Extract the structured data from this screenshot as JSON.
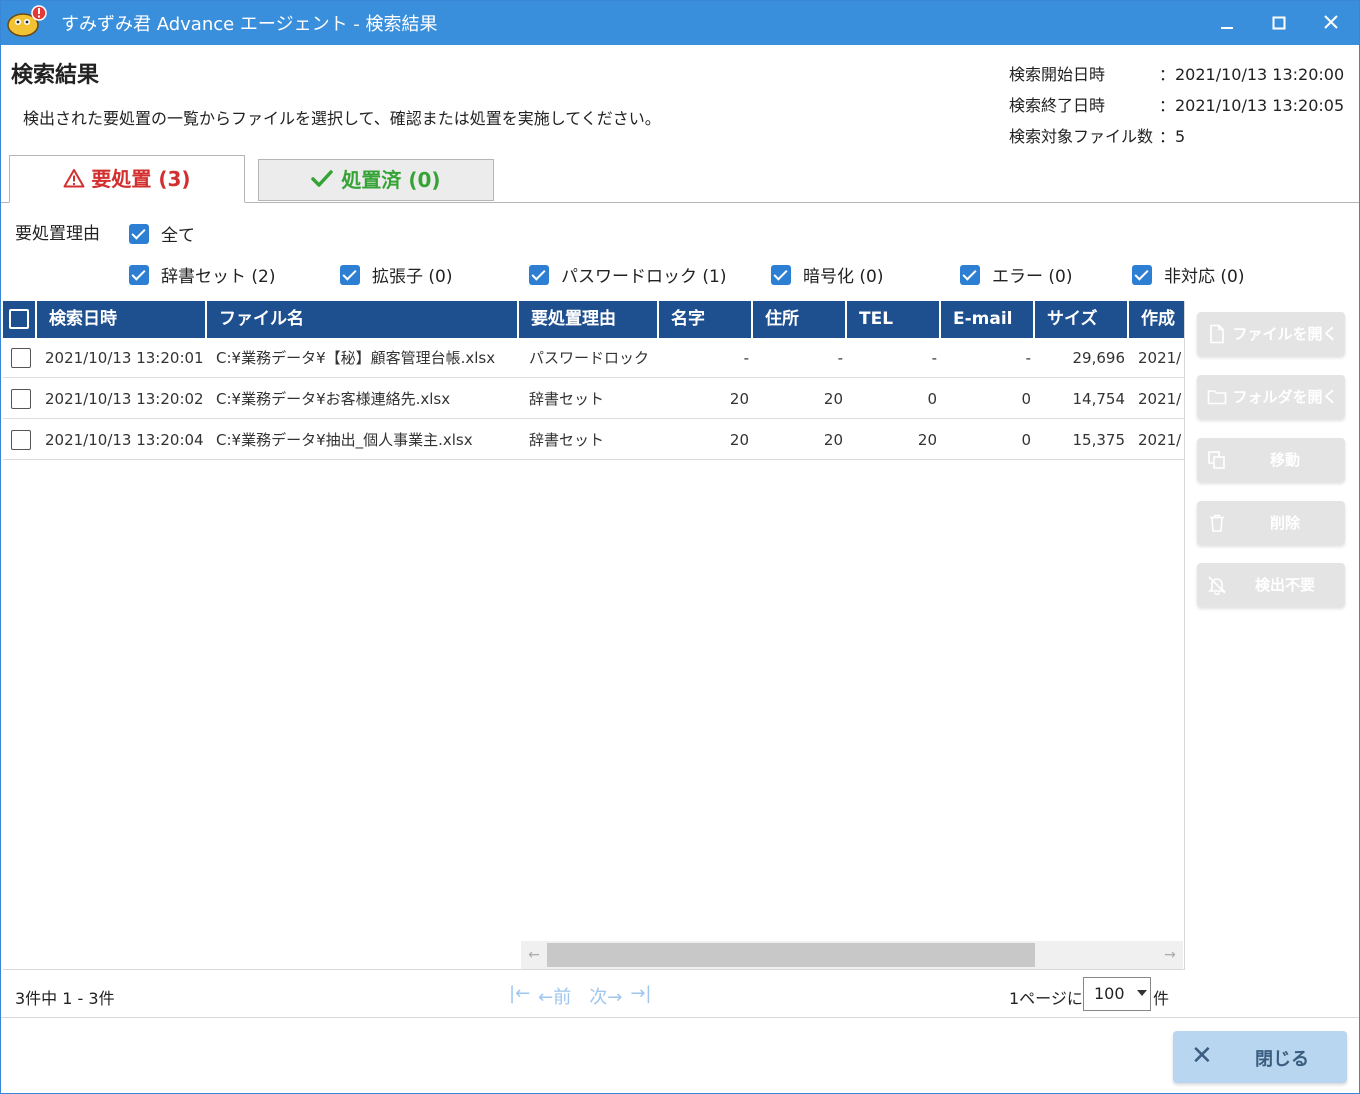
{
  "window": {
    "title": "すみずみ君 Advance エージェント - 検索結果"
  },
  "page": {
    "title": "検索結果",
    "description": "検出された要処置の一覧からファイルを選択して、確認または処置を実施してください。"
  },
  "meta": [
    {
      "label": "検索開始日時",
      "value": "：2021/10/13 13:20:00"
    },
    {
      "label": "検索終了日時",
      "value": "：2021/10/13 13:20:05"
    },
    {
      "label": "検索対象ファイル数",
      "value": "：5"
    }
  ],
  "tabs": [
    {
      "label": "要処置 (3)",
      "icon": "warning-icon",
      "color": "#d32f2f"
    },
    {
      "label": "処置済 (0)",
      "icon": "check-icon",
      "color": "#36a336"
    }
  ],
  "filters": {
    "label": "要処置理由",
    "all": "全て",
    "items": [
      "辞書セット (2)",
      "拡張子 (0)",
      "パスワードロック (1)",
      "暗号化 (0)",
      "エラー (0)",
      "非対応 (0)"
    ]
  },
  "table": {
    "columns": [
      "検索日時",
      "ファイル名",
      "要処置理由",
      "名字",
      "住所",
      "TEL",
      "E-mail",
      "サイズ",
      "作成"
    ],
    "rows": [
      [
        "2021/10/13 13:20:01",
        "C:¥業務データ¥【秘】顧客管理台帳.xlsx",
        "パスワードロック",
        "-",
        "-",
        "-",
        "-",
        "29,696",
        "2021/"
      ],
      [
        "2021/10/13 13:20:02",
        "C:¥業務データ¥お客様連絡先.xlsx",
        "辞書セット",
        "20",
        "20",
        "0",
        "0",
        "14,754",
        "2021/"
      ],
      [
        "2021/10/13 13:20:04",
        "C:¥業務データ¥抽出_個人事業主.xlsx",
        "辞書セット",
        "20",
        "20",
        "20",
        "0",
        "15,375",
        "2021/"
      ]
    ]
  },
  "side_buttons": [
    {
      "label": "ファイルを開く",
      "icon": "file-icon"
    },
    {
      "label": "フォルダを開く",
      "icon": "folder-icon"
    },
    {
      "label": "移動",
      "icon": "copy-icon"
    },
    {
      "label": "削除",
      "icon": "trash-icon"
    },
    {
      "label": "検出不要",
      "icon": "bell-off-icon"
    }
  ],
  "footer": {
    "count": "3件中 1 - 3件",
    "pager": {
      "first": "|←",
      "prev": "←前",
      "next": "次→",
      "last": "→|"
    },
    "per_page_label": "1ページに",
    "per_page_value": "100",
    "per_page_unit": "件"
  },
  "close_button": {
    "label": "閉じる"
  },
  "colors": {
    "titlebar": "#3a8fdc",
    "header": "#1e4f8f",
    "checkbox": "#2d7fd4"
  }
}
